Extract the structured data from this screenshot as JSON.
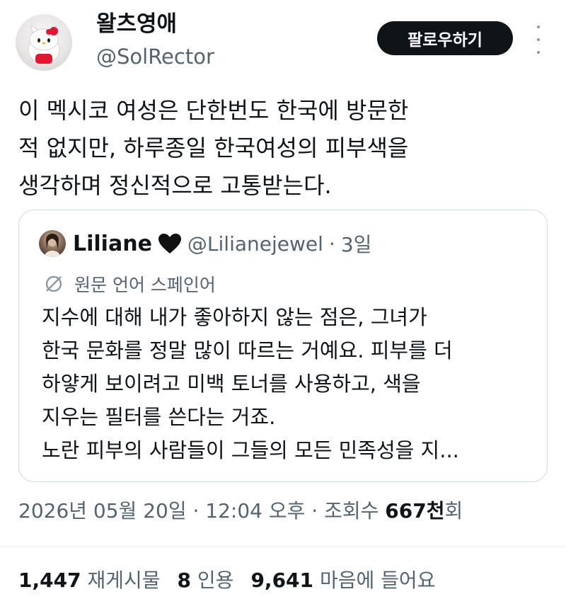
{
  "author": {
    "display_name": "왈츠영애",
    "handle": "@SolRector",
    "avatar_icon": "hello-kitty-avatar"
  },
  "follow_label": "팔로우하기",
  "more_icon": "more-vertical-icon",
  "tweet_text": "이 멕시코 여성은 단한번도 한국에 방문한\n적 없지만, 하루종일 한국여성의 피부색을\n생각하며 정신적으로 고통받는다.",
  "quote": {
    "name": "Liliane",
    "heart_icon": "black-heart-icon",
    "handle": "@Lilianejewel",
    "separator": "·",
    "time": "3일",
    "translate_label": "원문 언어 스페인어",
    "translate_icon": "translate-icon",
    "body": "지수에 대해 내가 좋아하지 않는 점은, 그녀가\n한국 문화를 정말 많이 따르는 거예요. 피부를 더\n하얗게 보이려고 미백 토너를 사용하고, 색을\n지우는 필터를 쓴다는 거죠.\n노란 피부의 사람들이 그들의 모든 민족성을 지..."
  },
  "meta": {
    "date": "2026년 05월 20일 · 12:04 오후 · 조회수 ",
    "views_value": "667천",
    "views_suffix": "회"
  },
  "stats": {
    "retweets_value": "1,447",
    "retweets_label": "재게시물",
    "quotes_value": "8",
    "quotes_label": "인용",
    "likes_value": "9,641",
    "likes_label": "마음에 들어요"
  },
  "colors": {
    "text": "#0f1419",
    "muted": "#536471",
    "border": "#cfd9de",
    "button": "#0f1419"
  }
}
